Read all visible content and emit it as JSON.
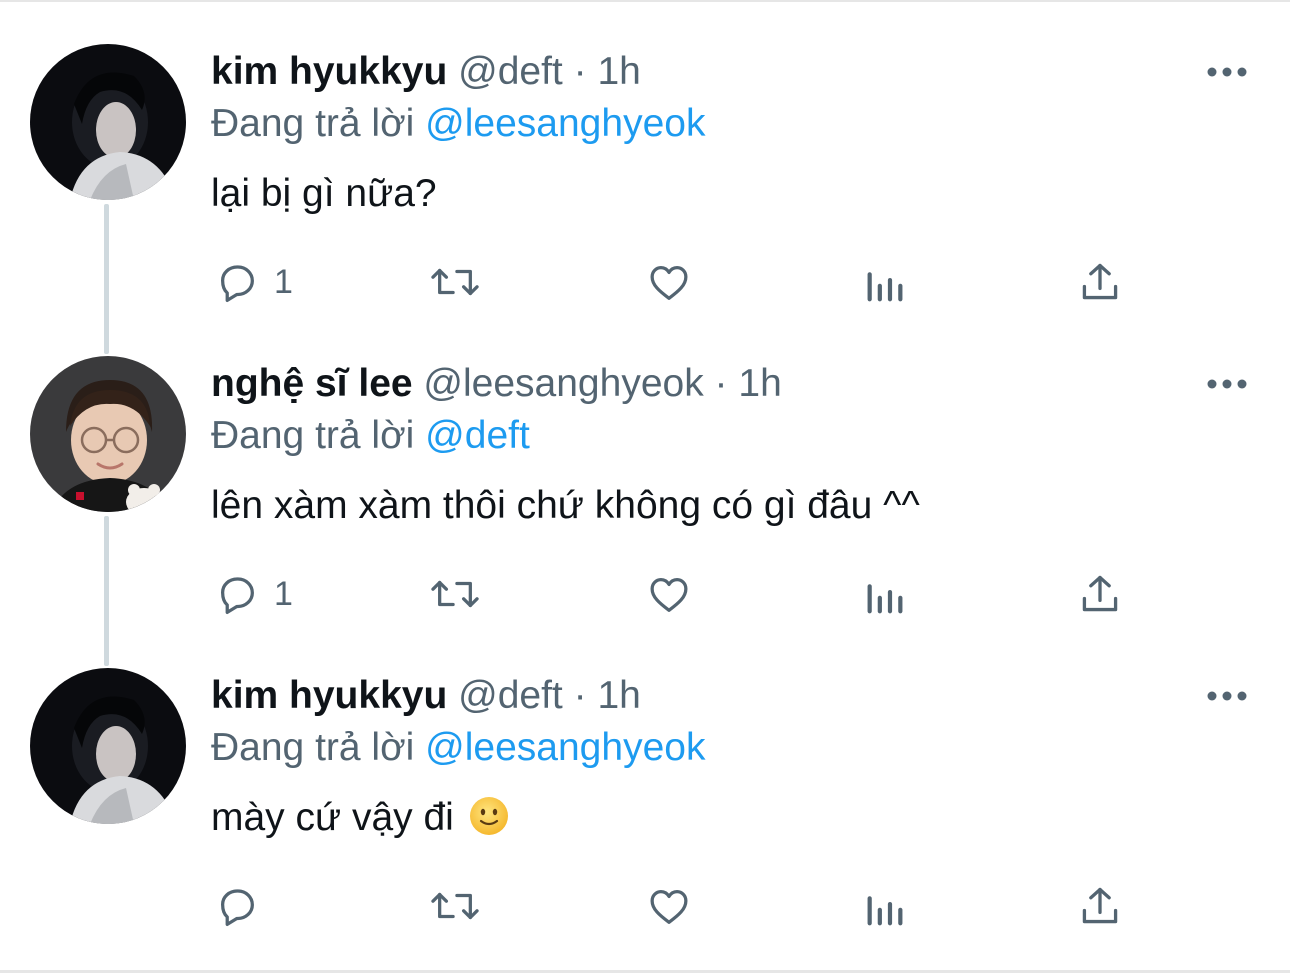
{
  "colors": {
    "text": "#0f1419",
    "secondary": "#536471",
    "mention": "#1d9bf0",
    "thread_line": "#cfd9de"
  },
  "tweets": [
    {
      "display_name": "kim hyukkyu",
      "handle": "@deft",
      "separator": "·",
      "time": "1h",
      "reply_prefix": "Đang trả lời",
      "reply_to": "@leesanghyeok",
      "text": "lại bị gì nữa?",
      "reply_count": "1",
      "avatar": "avatar-dark-hair-white-jacket"
    },
    {
      "display_name": "nghệ sĩ lee",
      "handle": "@leesanghyeok",
      "separator": "·",
      "time": "1h",
      "reply_prefix": "Đang trả lời",
      "reply_to": "@deft",
      "text": "lên xàm xàm thôi chứ không có gì đâu ^^",
      "reply_count": "1",
      "avatar": "avatar-glasses-black-jersey"
    },
    {
      "display_name": "kim hyukkyu",
      "handle": "@deft",
      "separator": "·",
      "time": "1h",
      "reply_prefix": "Đang trả lời",
      "reply_to": "@leesanghyeok",
      "text": "mày cứ vậy đi",
      "emoji": "slightly-smiling-face-emoji",
      "reply_count": "",
      "avatar": "avatar-dark-hair-white-jacket"
    }
  ],
  "icons": {
    "reply": "reply-bubble-icon",
    "retweet": "retweet-icon",
    "like": "heart-icon",
    "views": "bar-chart-icon",
    "share": "share-upload-icon",
    "more": "more-dots-icon"
  }
}
